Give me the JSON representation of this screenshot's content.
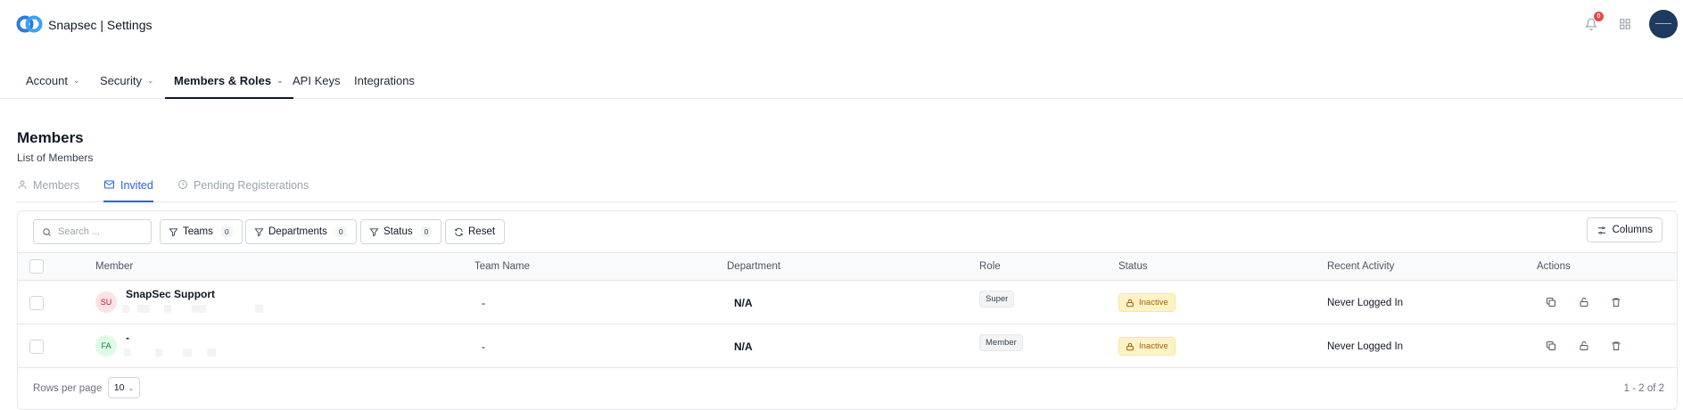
{
  "app": {
    "title": "Snapsec | Settings",
    "notification_count": "0"
  },
  "colors": {
    "accent": "#2563eb",
    "logo_blue": "#2a7bdc",
    "inactive_bg": "#fef3c7",
    "inactive_text": "#a16207"
  },
  "nav": {
    "tabs": [
      {
        "label": "Account",
        "has_chevron": true
      },
      {
        "label": "Security",
        "has_chevron": true
      },
      {
        "label": "Members & Roles",
        "has_chevron": true,
        "active": true
      },
      {
        "label": "API Keys",
        "has_chevron": false
      },
      {
        "label": "Integrations",
        "has_chevron": false
      }
    ]
  },
  "section": {
    "title": "Members",
    "subtitle": "List of Members"
  },
  "subtabs": [
    {
      "label": "Members",
      "icon": "user-icon"
    },
    {
      "label": "Invited",
      "icon": "mail-check-icon",
      "active": true
    },
    {
      "label": "Pending Registerations",
      "icon": "clock-icon"
    }
  ],
  "toolbar": {
    "search_placeholder": "Search ...",
    "filters": [
      {
        "label": "Teams",
        "count": "0"
      },
      {
        "label": "Departments",
        "count": "0"
      },
      {
        "label": "Status",
        "count": "0"
      }
    ],
    "reset_label": "Reset",
    "columns_label": "Columns"
  },
  "table": {
    "headers": [
      "Member",
      "Team Name",
      "Department",
      "Role",
      "Status",
      "Recent Activity",
      "Actions"
    ],
    "rows": [
      {
        "initials": "SU",
        "name": "SnapSec Support",
        "team": "-",
        "department": "N/A",
        "role": "Super",
        "status": "Inactive",
        "activity": "Never Logged In"
      },
      {
        "initials": "FA",
        "name": "-",
        "team": "-",
        "department": "N/A",
        "role": "Member",
        "status": "Inactive",
        "activity": "Never Logged In"
      }
    ]
  },
  "footer": {
    "rows_per_page_label": "Rows per page",
    "rows_per_page_value": "10",
    "pagination": "1 - 2 of 2"
  }
}
